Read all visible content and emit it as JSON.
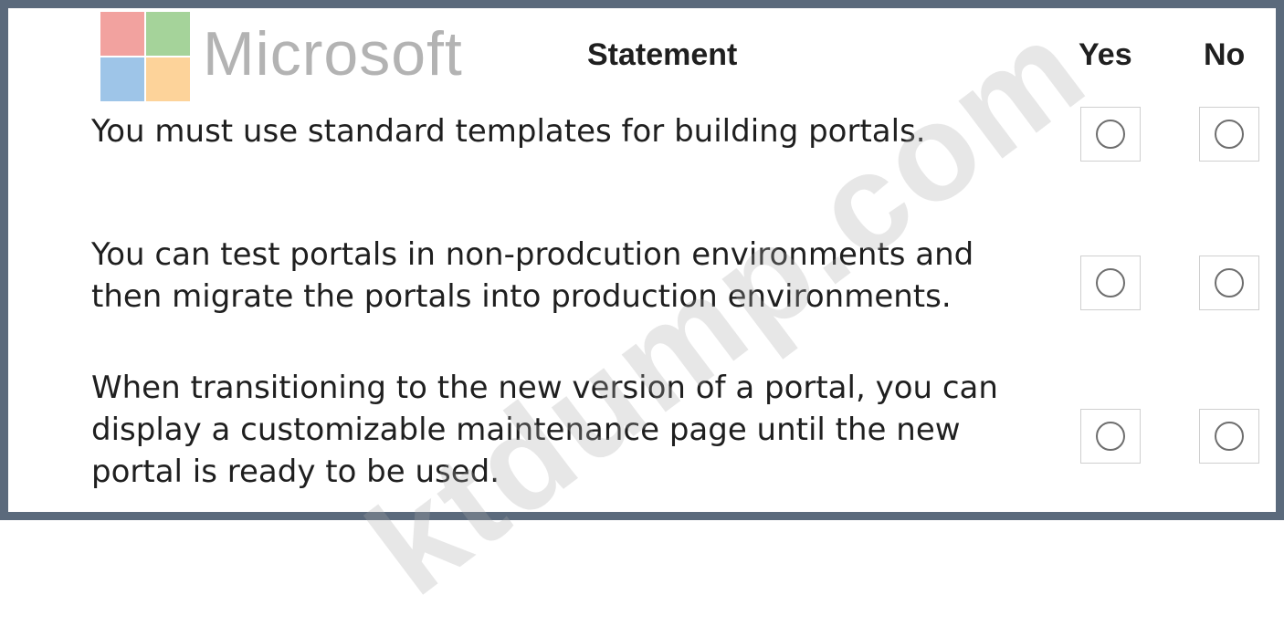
{
  "logo": {
    "text": "Microsoft",
    "colors": [
      "#f2a29f",
      "#a5d39a",
      "#9ec5e8",
      "#fdd39a"
    ]
  },
  "headers": {
    "statement": "Statement",
    "yes": "Yes",
    "no": "No"
  },
  "rows": [
    {
      "lines": [
        "You must use standard templates for building portals."
      ],
      "yes_selected": false,
      "no_selected": false
    },
    {
      "lines": [
        "You can test portals in non-prodcution environments and",
        "then migrate the portals into production environments."
      ],
      "yes_selected": false,
      "no_selected": false
    },
    {
      "lines": [
        "When transitioning to the new version of a portal, you can",
        "display a customizable maintenance page until the new",
        "portal is ready to be used."
      ],
      "yes_selected": false,
      "no_selected": false
    }
  ],
  "watermark": "ktdump.com"
}
